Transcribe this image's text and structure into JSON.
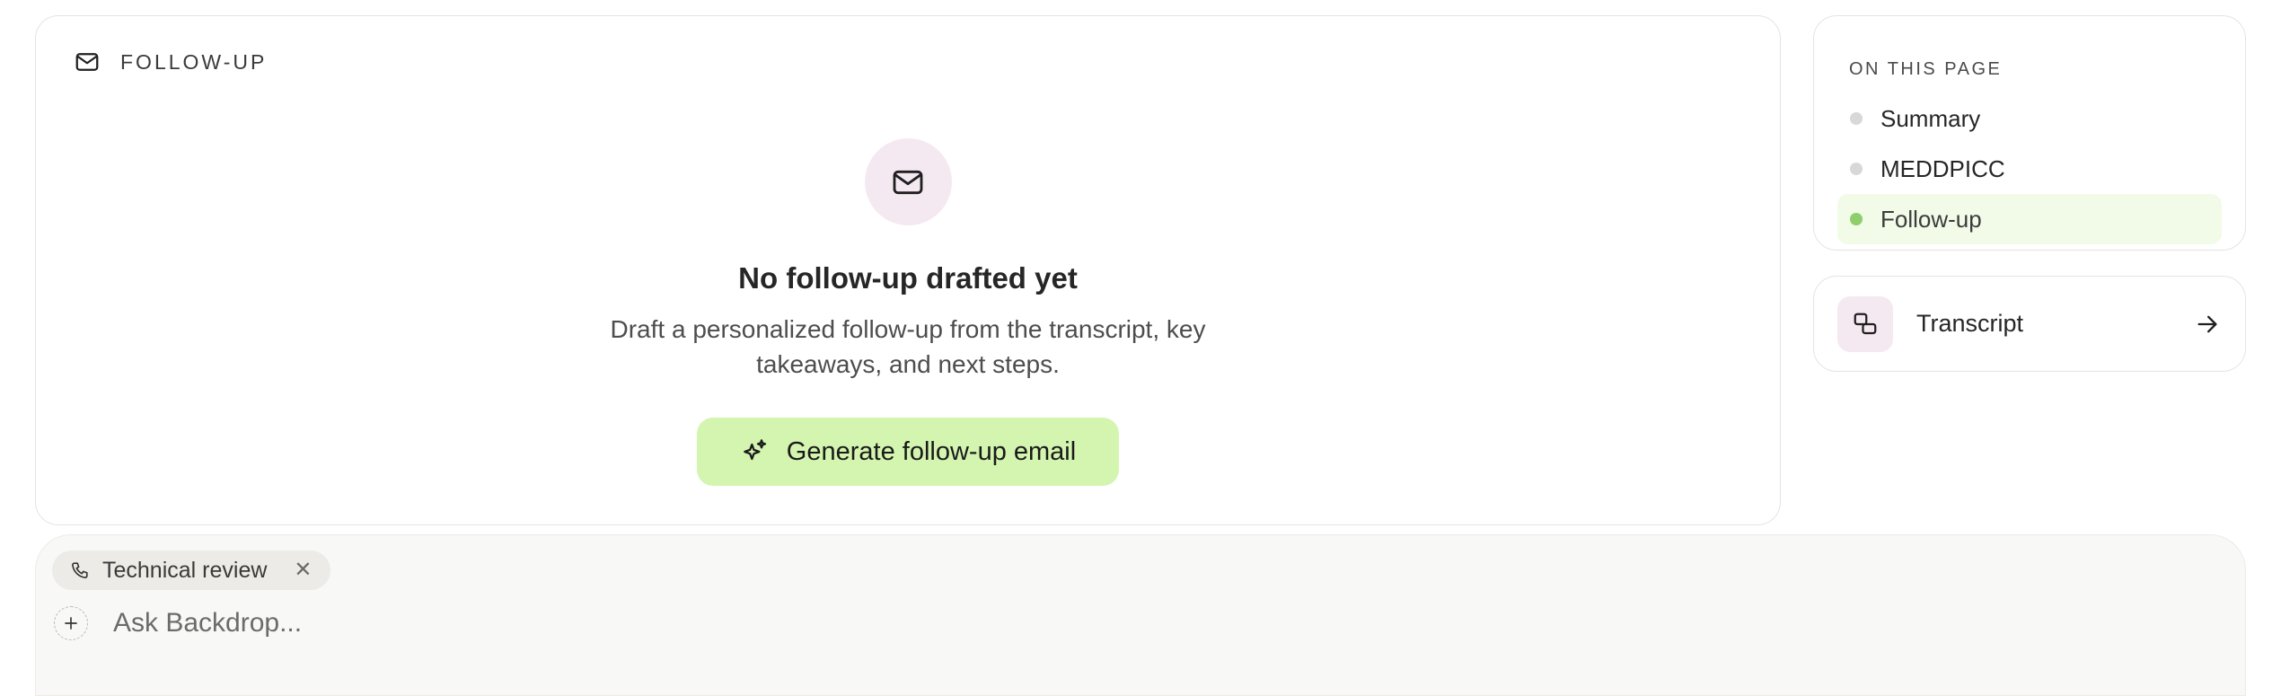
{
  "followup_card": {
    "header_label": "FOLLOW-UP",
    "header_icon": "mail-icon",
    "empty_icon": "mail-icon",
    "empty_title": "No follow-up drafted yet",
    "empty_description": "Draft a personalized follow-up from the transcript, key takeaways, and next steps.",
    "generate_button_label": "Generate follow-up email",
    "generate_button_icon": "sparkle-icon",
    "generate_button_color": "#d4f5b0"
  },
  "toc": {
    "title": "ON THIS PAGE",
    "items": [
      {
        "label": "Summary",
        "active": false
      },
      {
        "label": "MEDDPICC",
        "active": false
      },
      {
        "label": "Follow-up",
        "active": true
      }
    ],
    "active_color": "#8fce6a"
  },
  "transcript": {
    "label": "Transcript",
    "icon": "chat-bubbles-icon",
    "arrow_icon": "arrow-right-icon"
  },
  "ask_bar": {
    "context_chip": {
      "icon": "phone-icon",
      "label": "Technical review",
      "close_glyph": "✕"
    },
    "add_icon": "plus-icon",
    "placeholder": "Ask Backdrop..."
  }
}
